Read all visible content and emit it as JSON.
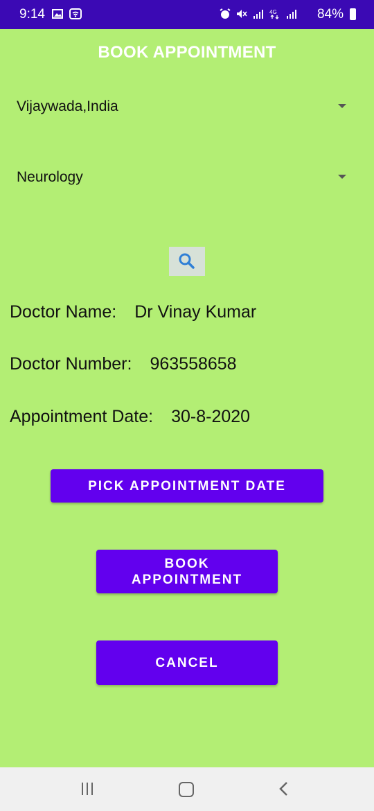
{
  "status_bar": {
    "time": "9:14",
    "battery": "84%",
    "icons": [
      "image-icon",
      "wifi-icon",
      "alarm-icon",
      "mute-icon",
      "signal-icon",
      "4g-icon",
      "signal-icon"
    ]
  },
  "header": {
    "title": "BOOK APPOINTMENT"
  },
  "location_spinner": {
    "value": "Vijaywada,India"
  },
  "specialty_spinner": {
    "value": "Neurology"
  },
  "search": {
    "icon": "search-icon"
  },
  "details": {
    "doctor_name_label": "Doctor Name:",
    "doctor_name": "Dr Vinay Kumar",
    "doctor_number_label": "Doctor Number:",
    "doctor_number": "963558658",
    "appointment_date_label": "Appointment Date:",
    "appointment_date": "30-8-2020"
  },
  "buttons": {
    "pick_date": "PICK APPOINTMENT DATE",
    "book_line1": "BOOK",
    "book_line2": "APPOINTMENT",
    "cancel": "CANCEL"
  },
  "colors": {
    "background": "#b3ee74",
    "status_bar": "#3b09b4",
    "button": "#6200ee",
    "search_icon": "#2f7fd6"
  }
}
